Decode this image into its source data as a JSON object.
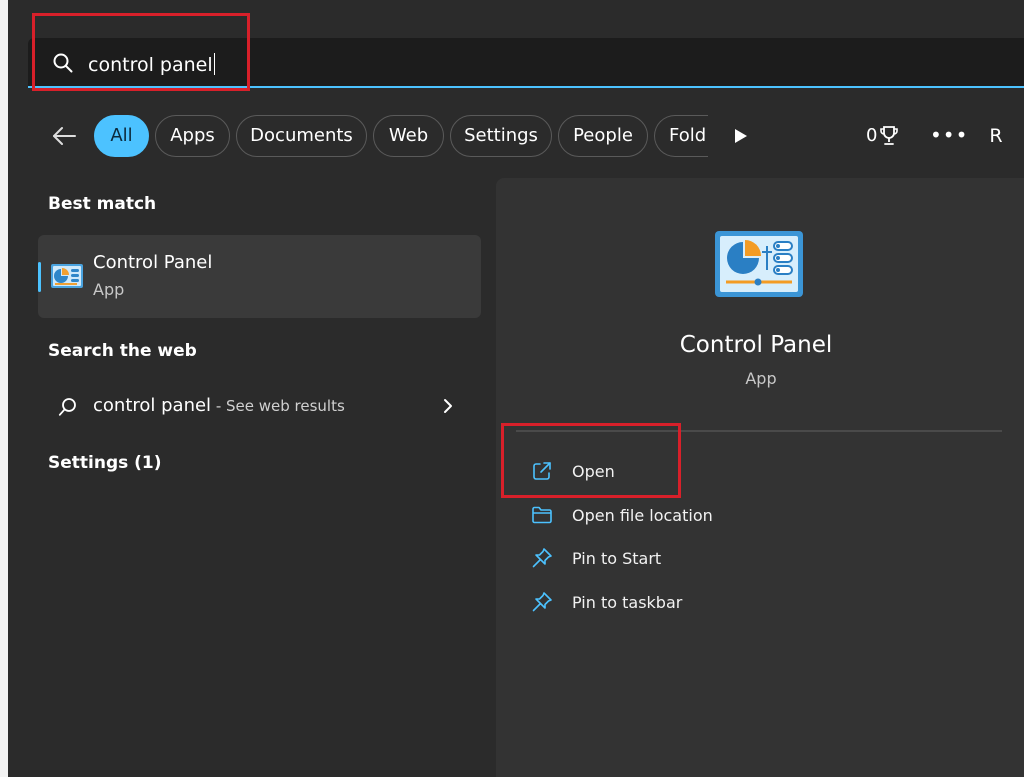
{
  "search": {
    "query": "control panel"
  },
  "filters": {
    "items": [
      "All",
      "Apps",
      "Documents",
      "Web",
      "Settings",
      "People",
      "Fold"
    ],
    "points": "0",
    "avatar_initial": "R"
  },
  "results": {
    "best_match_heading": "Best match",
    "best_match": {
      "title": "Control Panel",
      "subtitle": "App"
    },
    "search_web_heading": "Search the web",
    "web_query": "control panel",
    "web_suffix": " - See web results",
    "settings_heading": "Settings (1)"
  },
  "detail": {
    "title": "Control Panel",
    "subtitle": "App",
    "actions": [
      "Open",
      "Open file location",
      "Pin to Start",
      "Pin to taskbar"
    ]
  },
  "colors": {
    "accent": "#4cc2ff",
    "highlight": "#d8202a",
    "pane": "#333333",
    "background": "#2b2b2b"
  },
  "icons": [
    "search-icon",
    "back-arrow-icon",
    "play-icon",
    "trophy-icon",
    "more-icon",
    "control-panel-icon",
    "open-icon",
    "folder-icon",
    "pin-icon",
    "chevron-right-icon"
  ]
}
